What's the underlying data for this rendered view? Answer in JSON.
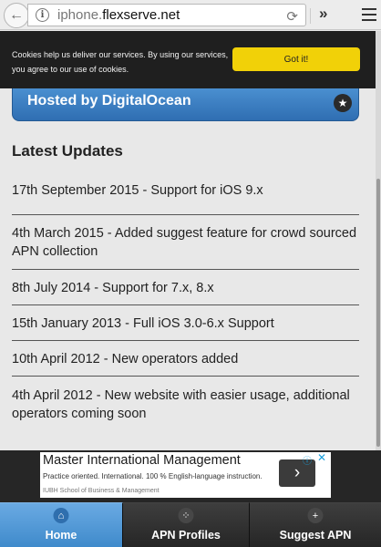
{
  "browser": {
    "url_prefix": "iphone.",
    "url_domain": "flexserve.net",
    "back_icon": "←",
    "info_icon": "i",
    "reload_icon": "⟳",
    "overflow_icon": "»"
  },
  "cookie": {
    "text": "Cookies help us deliver our services. By using our services, you agree to our use of cookies.",
    "button": "Got it!"
  },
  "hosted": {
    "label": "Hosted by DigitalOcean",
    "icon": "★"
  },
  "updates": {
    "heading": "Latest Updates",
    "items": [
      "17th September 2015 - Support for iOS 9.x",
      "4th March 2015 - Added suggest feature for crowd sourced APN collection",
      "8th July 2014 - Support for 7.x, 8.x",
      "15th January 2013 - Full iOS 3.0-6.x Support",
      "10th April 2012 - New operators added",
      "4th April 2012 - New website with easier usage, additional operators coming soon"
    ]
  },
  "ad": {
    "title": "Master International Management",
    "text": "Practice oriented. International. 100 % English-language instruction.",
    "source": "IUBH School of Business & Management",
    "arrow": "›",
    "adchoice_icon": "ⓘ",
    "close_icon": "✕"
  },
  "nav": {
    "items": [
      {
        "label": "Home",
        "icon": "⌂"
      },
      {
        "label": "APN Profiles",
        "icon": "⁘"
      },
      {
        "label": "Suggest APN",
        "icon": "+"
      }
    ]
  }
}
